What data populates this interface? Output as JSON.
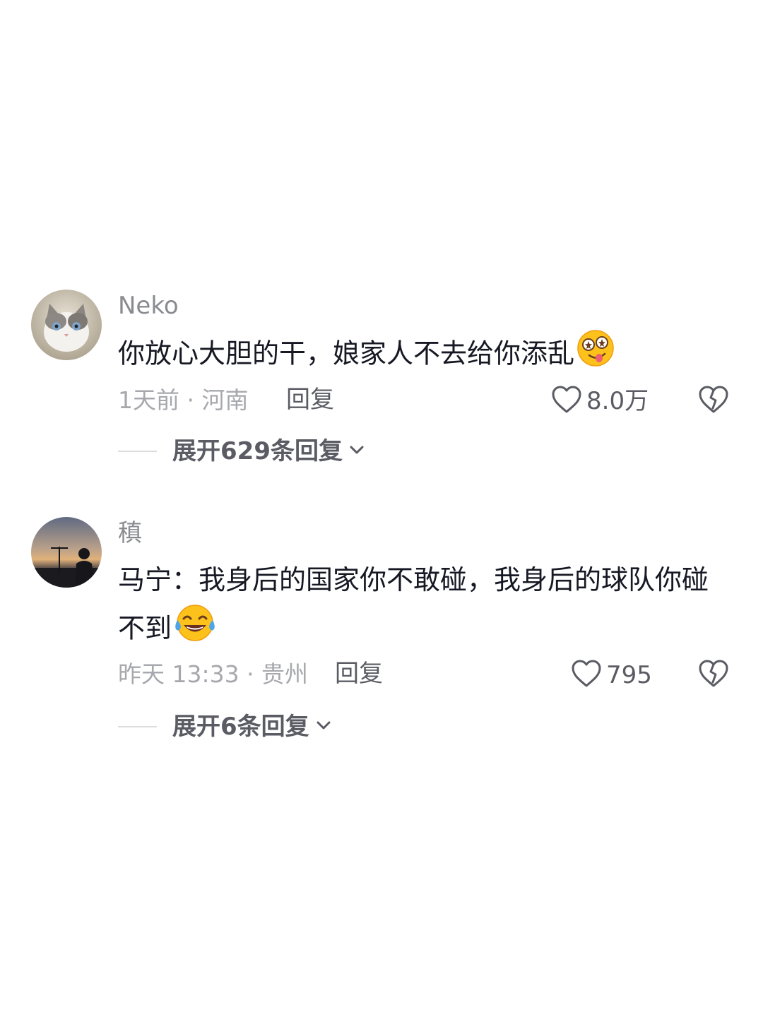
{
  "comments": [
    {
      "username": "Neko",
      "text": "你放心大胆的干，娘家人不去给你添乱",
      "emoji": "drooling-starry-eyed-face-emoji",
      "meta": "1天前 · 河南",
      "reply_label": "回复",
      "like_count": "8.0万",
      "expand_label": "展开629条回复",
      "avatar": "cat-photo"
    },
    {
      "username": "稹",
      "text": "马宁：我身后的国家你不敢碰，我身后的球队你碰不到",
      "emoji": "tears-of-joy-emoji",
      "meta": "昨天 13:33 · 贵州",
      "reply_label": "回复",
      "like_count": "795",
      "expand_label": "展开6条回复",
      "avatar": "sunset-silhouette-photo"
    }
  ],
  "colors": {
    "primary_text": "#161823",
    "secondary_text": "#a7a8ad",
    "action_text": "#5a5b63"
  },
  "icons": [
    "heart-outline-icon",
    "broken-heart-icon",
    "chevron-down-icon"
  ]
}
